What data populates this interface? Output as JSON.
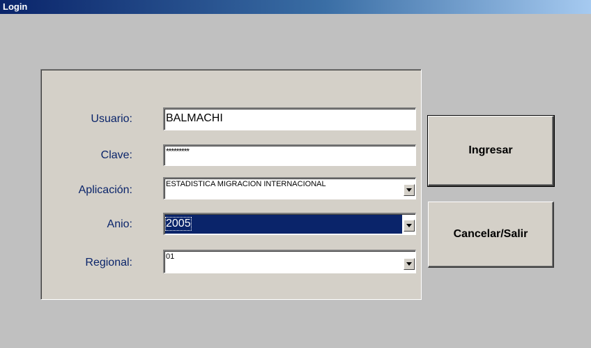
{
  "window": {
    "title": "Login"
  },
  "form": {
    "usuario_label": "Usuario:",
    "usuario_value": "BALMACHI",
    "clave_label": "Clave:",
    "clave_value": "*********",
    "aplicacion_label": "Aplicación:",
    "aplicacion_value": "ESTADISTICA MIGRACION INTERNACIONAL",
    "anio_label": "Anio:",
    "anio_value": "2005",
    "regional_label": "Regional:",
    "regional_value": "01"
  },
  "buttons": {
    "ingresar_label": "Ingresar",
    "cancelar_label": "Cancelar/Salir"
  },
  "colors": {
    "titlebar_start": "#0a246a",
    "titlebar_end": "#a6caf0",
    "label_text": "#0a246a",
    "selection": "#0a246a",
    "window_bg": "#c0c0c0",
    "panel_bg": "#d4d0c8"
  },
  "icons": {
    "dropdown": "chevron-down-icon"
  }
}
